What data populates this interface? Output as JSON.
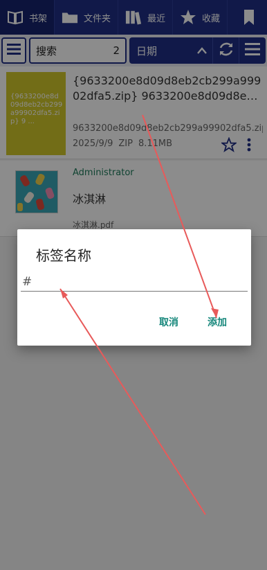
{
  "nav": {
    "bookshelf": "书架",
    "folders": "文件夹",
    "recent": "最近",
    "favorites": "收藏"
  },
  "toolbar": {
    "search_label": "搜索",
    "search_count": "2",
    "sort_label": "日期"
  },
  "books": [
    {
      "cover_text": "{9633200e8d09d8eb2cb299a99902dfa5.zip} 9 ...",
      "title_line1": "{9633200e8d09d8eb2cb299a999",
      "title_line2": "02dfa5.zip} 9633200e8d09d8e…",
      "file": "9633200e8d09d8eb2cb299a99902dfa5.zip",
      "date": "2025/9/9",
      "type": "ZIP",
      "size": "8.11MB"
    },
    {
      "author": "Administrator",
      "title": "冰淇淋",
      "file": "冰淇淋.pdf"
    }
  ],
  "dialog": {
    "title": "标签名称",
    "input_value": "#",
    "cancel": "取消",
    "add": "添加"
  },
  "colors": {
    "nav_bg": "#1f2f86",
    "accent_teal": "#14867a",
    "annotation_arrow": "#e85a5a"
  }
}
